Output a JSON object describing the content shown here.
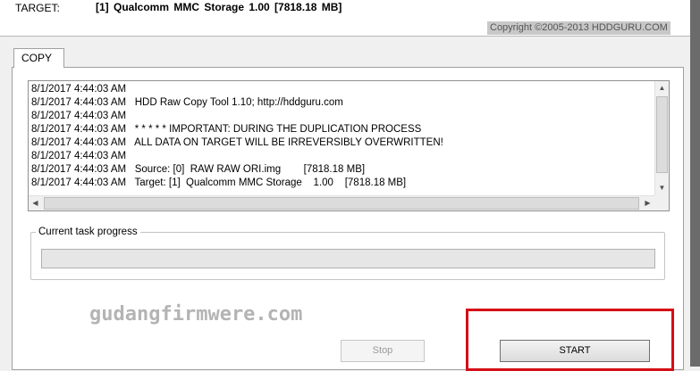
{
  "target": {
    "label": "TARGET:",
    "value": "[1]  Qualcomm MMC Storage    1.00    [7818.18 MB]"
  },
  "copyright": "Copyright ©2005-2013 HDDGURU.COM",
  "tabs": [
    {
      "label": "COPY"
    }
  ],
  "log": [
    "8/1/2017 4:44:03 AM",
    "8/1/2017 4:44:03 AM   HDD Raw Copy Tool 1.10; http://hddguru.com",
    "8/1/2017 4:44:03 AM",
    "8/1/2017 4:44:03 AM   * * * * * IMPORTANT: DURING THE DUPLICATION PROCESS",
    "8/1/2017 4:44:03 AM   ALL DATA ON TARGET WILL BE IRREVERSIBLY OVERWRITTEN!",
    "8/1/2017 4:44:03 AM",
    "8/1/2017 4:44:03 AM   Source: [0]  RAW RAW ORI.img        [7818.18 MB]",
    "8/1/2017 4:44:03 AM   Target: [1]  Qualcomm MMC Storage    1.00    [7818.18 MB]"
  ],
  "progress": {
    "label": "Current task progress",
    "value": 0
  },
  "watermark": "gudangfirmwere.com",
  "buttons": {
    "stop": "Stop",
    "start": "START"
  },
  "colors": {
    "highlight": "#d40f16",
    "progress_fill": "#06b025"
  }
}
